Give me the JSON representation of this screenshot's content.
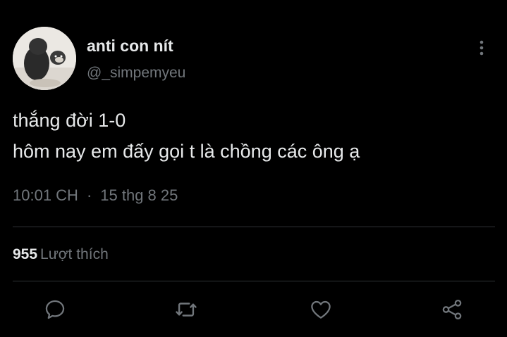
{
  "tweet": {
    "display_name": "anti con nít",
    "handle": "@_simpemyeu",
    "text_lines": [
      "thắng đời 1-0",
      "hôm nay em đấy gọi t là chồng các ông ạ"
    ],
    "time": "10:01 CH",
    "separator": "·",
    "date": "15 thg 8 25",
    "likes_count": "955",
    "likes_label": "Lượt thích"
  },
  "icons": {
    "more": "more-vertical-icon",
    "reply": "reply-icon",
    "retweet": "retweet-icon",
    "like": "heart-icon",
    "share": "share-icon"
  },
  "colors": {
    "background": "#000000",
    "primary_text": "#e7e9ea",
    "secondary_text": "#71767b",
    "divider": "#2f3336"
  }
}
